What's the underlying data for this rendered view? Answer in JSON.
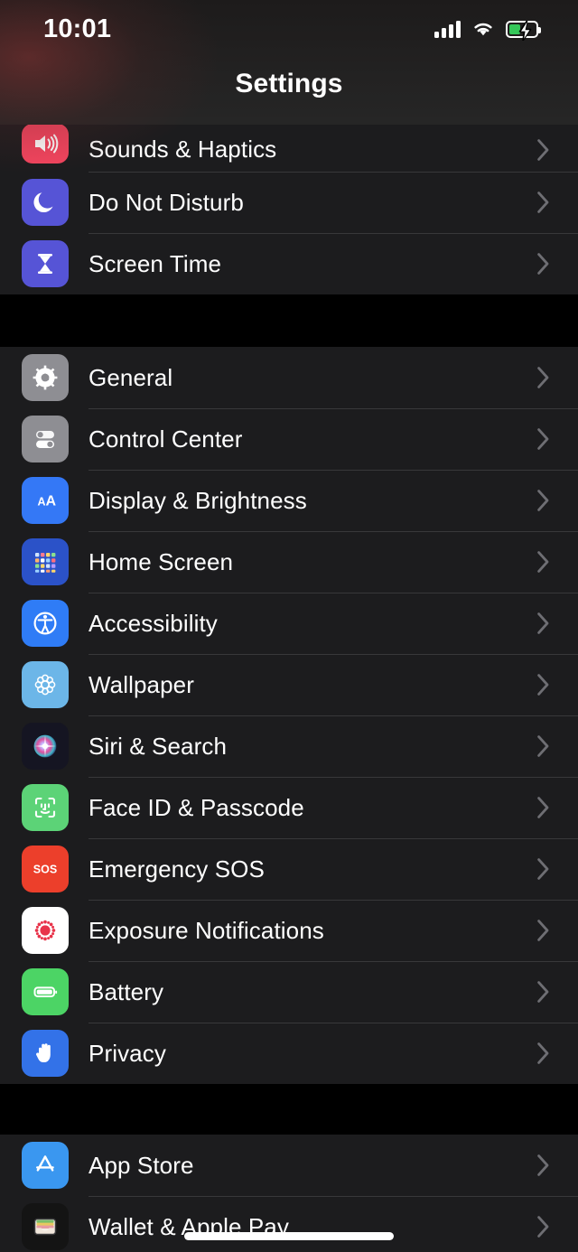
{
  "status_bar": {
    "time": "10:01",
    "signal_icon": "cellular-signal-icon",
    "wifi_icon": "wifi-icon",
    "battery_icon": "battery-charging-icon",
    "battery_charging": true
  },
  "header": {
    "title": "Settings"
  },
  "colors": {
    "background": "#000000",
    "row_background": "#1c1c1e",
    "separator": "#38383a",
    "label": "#ffffff",
    "chevron": "#6e6e73",
    "sounds_red": "#f4455f",
    "dnd_purple": "#5654d6",
    "screentime_purple": "#5654d6",
    "general_gray": "#8e8e93",
    "control_gray": "#8e8e93",
    "display_blue": "#3478f6",
    "home_blue": "#2b52c8",
    "accessibility_blue": "#2f7cf6",
    "wallpaper_blue": "#6cb6e8",
    "siri_dark": "#1c1c2e",
    "faceid_green": "#5cd377",
    "sos_red": "#ec3f2b",
    "exposure_white": "#ffffff",
    "exposure_red": "#e8334a",
    "battery_green": "#4cd465",
    "privacy_blue": "#3372e8",
    "appstore_blue": "#3a97f0",
    "wallet_dark": "#161616"
  },
  "groups": [
    {
      "name": "group-notifications",
      "items": [
        {
          "label": "Sounds & Haptics",
          "icon": "sounds-haptics-icon",
          "clipped": true
        },
        {
          "label": "Do Not Disturb",
          "icon": "do-not-disturb-icon",
          "clipped": false
        },
        {
          "label": "Screen Time",
          "icon": "screen-time-icon",
          "clipped": false
        }
      ]
    },
    {
      "name": "group-system",
      "items": [
        {
          "label": "General",
          "icon": "general-gear-icon",
          "clipped": false
        },
        {
          "label": "Control Center",
          "icon": "control-center-icon",
          "clipped": false
        },
        {
          "label": "Display & Brightness",
          "icon": "display-brightness-icon",
          "clipped": false
        },
        {
          "label": "Home Screen",
          "icon": "home-screen-icon",
          "clipped": false
        },
        {
          "label": "Accessibility",
          "icon": "accessibility-icon",
          "clipped": false
        },
        {
          "label": "Wallpaper",
          "icon": "wallpaper-icon",
          "clipped": false
        },
        {
          "label": "Siri & Search",
          "icon": "siri-search-icon",
          "clipped": false
        },
        {
          "label": "Face ID & Passcode",
          "icon": "face-id-icon",
          "clipped": false
        },
        {
          "label": "Emergency SOS",
          "icon": "emergency-sos-icon",
          "clipped": false
        },
        {
          "label": "Exposure Notifications",
          "icon": "exposure-notifications-icon",
          "clipped": false
        },
        {
          "label": "Battery",
          "icon": "battery-icon",
          "clipped": false
        },
        {
          "label": "Privacy",
          "icon": "privacy-hand-icon",
          "clipped": false
        }
      ]
    },
    {
      "name": "group-stores",
      "items": [
        {
          "label": "App Store",
          "icon": "app-store-icon",
          "clipped": false
        },
        {
          "label": "Wallet & Apple Pay",
          "icon": "wallet-apple-pay-icon",
          "clipped": false
        }
      ]
    }
  ],
  "home_indicator": "home-indicator"
}
